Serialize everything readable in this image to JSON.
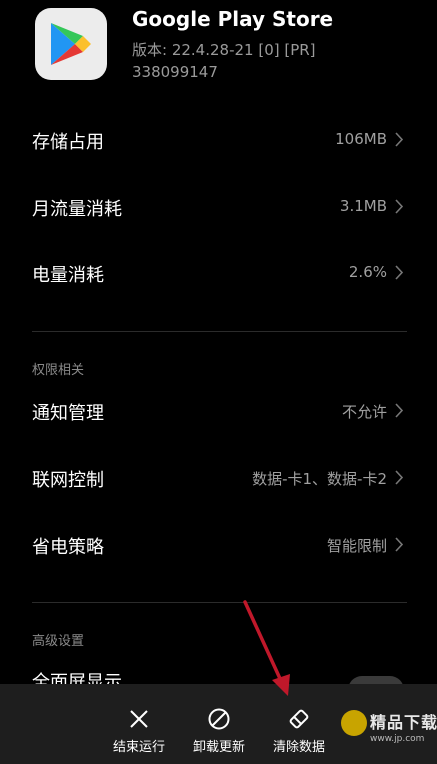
{
  "app": {
    "name": "Google Play Store",
    "version": "版本: 22.4.28-21 [0] [PR]",
    "build": "338099147",
    "icon": "google-play-icon"
  },
  "usage": [
    {
      "label": "存储占用",
      "value": "106MB"
    },
    {
      "label": "月流量消耗",
      "value": "3.1MB"
    },
    {
      "label": "电量消耗",
      "value": "2.6%"
    }
  ],
  "permissions": {
    "title": "权限相关",
    "items": [
      {
        "label": "通知管理",
        "value": "不允许"
      },
      {
        "label": "联网控制",
        "value": "数据-卡1、数据-卡2"
      },
      {
        "label": "省电策略",
        "value": "智能限制"
      }
    ]
  },
  "advanced": {
    "title": "高级设置",
    "items": [
      {
        "label": "全面屏显示"
      }
    ]
  },
  "bottom_bar": {
    "force_stop": "结束运行",
    "uninstall_updates": "卸载更新",
    "clear_data": "清除数据"
  },
  "watermark": {
    "text": "精品下载",
    "url": "www.jp.com"
  },
  "colors": {
    "background": "#000000",
    "secondary_text": "#a0a0a0",
    "bottom_bar": "#1e1e1e",
    "annotation_arrow": "#c0182a"
  }
}
